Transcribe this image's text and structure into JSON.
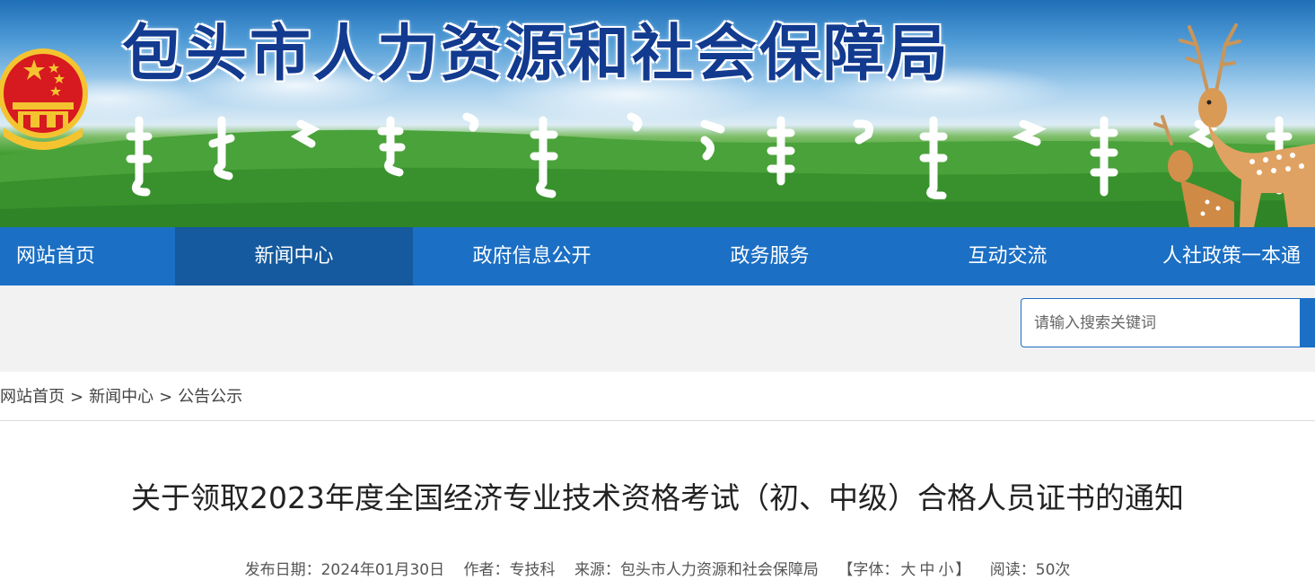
{
  "header": {
    "site_title": "包头市人力资源和社会保障局"
  },
  "nav": {
    "items": [
      {
        "label": "网站首页"
      },
      {
        "label": "新闻中心"
      },
      {
        "label": "政府信息公开"
      },
      {
        "label": "政务服务"
      },
      {
        "label": "互动交流"
      },
      {
        "label": "人社政策一本通"
      }
    ],
    "active_index": 1
  },
  "search": {
    "placeholder": "请输入搜索关键词"
  },
  "breadcrumb": {
    "items": [
      "网站首页",
      "新闻中心",
      "公告公示"
    ],
    "separator": ">"
  },
  "article": {
    "title": "关于领取2023年度全国经济专业技术资格考试（初、中级）合格人员证书的通知",
    "meta": {
      "date_label": "发布日期：",
      "date": "2024年01月30日",
      "author_label": "作者：",
      "author": "专技科",
      "source_label": "来源：",
      "source": "包头市人力资源和社会保障局",
      "font_open": "【字体：",
      "font_large": "大",
      "font_medium": "中",
      "font_small": "小",
      "font_close": "】",
      "reads_label": "阅读：",
      "reads": "50次"
    }
  },
  "colors": {
    "nav_bg": "#1b6fc4",
    "nav_active_bg": "#155a9e",
    "title_blue": "#123a8f",
    "search_band_bg": "#f2f2f2"
  },
  "icons": {
    "emblem": "national-emblem-icon",
    "deer": "deer-illustration"
  }
}
